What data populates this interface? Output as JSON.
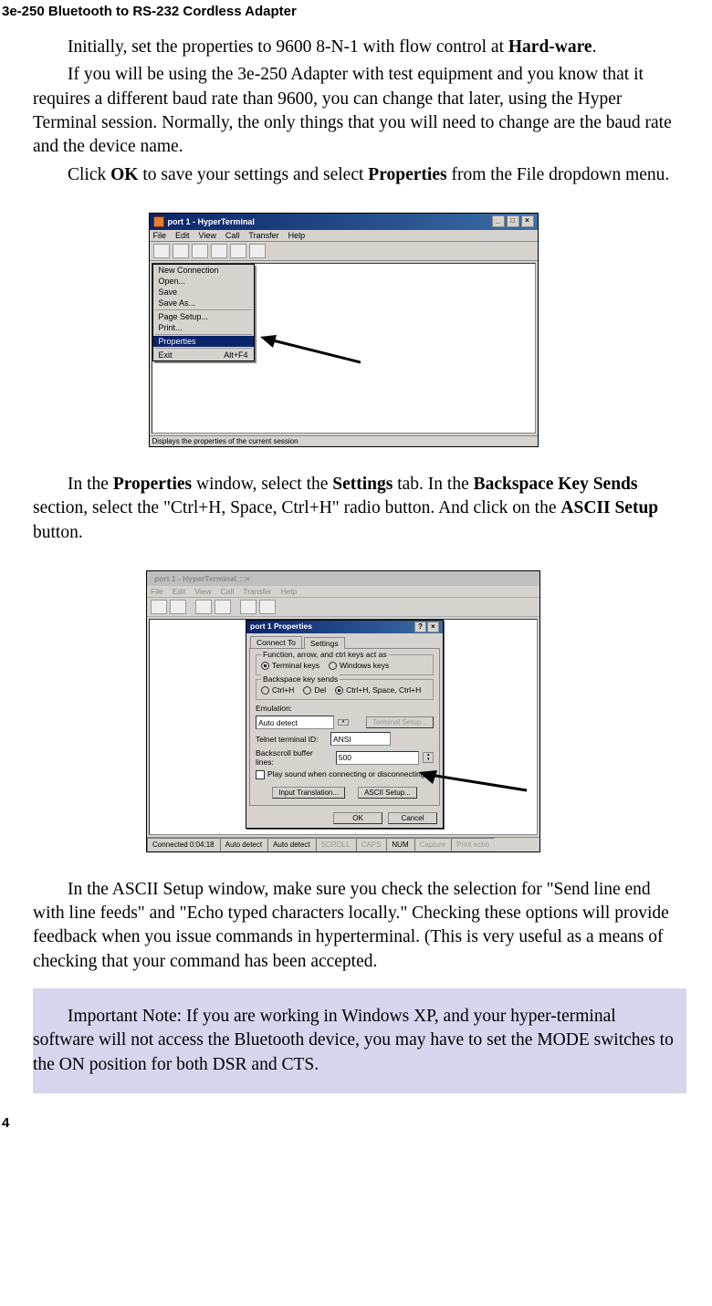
{
  "header": "3e-250 Bluetooth to RS-232 Cordless Adapter",
  "page_number": "4",
  "paragraphs": {
    "p1_a": "Initially, set the properties to 9600 8-N-1 with flow control at ",
    "p1_b": "Hard-ware",
    "p1_c": ".",
    "p2": "If you will be using the 3e-250 Adapter with test equipment and you know that it requires a different baud rate than 9600, you can change that later, using the Hyper Terminal session. Normally, the only things that you will need to change are the baud rate and the device name.",
    "p3_a": "Click ",
    "p3_b": "OK",
    "p3_c": " to save your settings and select ",
    "p3_d": "Properties",
    "p3_e": " from the File dropdown  menu.",
    "p4_a": "In the ",
    "p4_b": "Properties",
    "p4_c": " window, select the ",
    "p4_d": "Settings",
    "p4_e": " tab. In the ",
    "p4_f": "Backspace Key Sends",
    "p4_g": " section, select the \"Ctrl+H, Space, Ctrl+H\" radio button. And click on the ",
    "p4_h": "ASCII Setup",
    "p4_i": " button.",
    "p5": "In the ASCII Setup window, make sure you check the selection for \"Send line end with line feeds\" and \"Echo typed characters locally.\" Checking these options will provide feedback when you issue commands in hyperterminal.  (This is very useful as a means of checking that your command has been accepted.",
    "note": "Important Note: If you are working in Windows XP, and your hyper-terminal software will not access the Bluetooth device, you may have to set the MODE switches to the ON position for both DSR and CTS."
  },
  "fig1": {
    "title": "port 1 - HyperTerminal",
    "menus": [
      "File",
      "Edit",
      "View",
      "Call",
      "Transfer",
      "Help"
    ],
    "dropdown": {
      "items": [
        "New Connection",
        "Open...",
        "Save",
        "Save As..."
      ],
      "sep1_items": [
        "Page Setup...",
        "Print..."
      ],
      "highlight": "Properties",
      "exit": "Exit",
      "exit_accel": "Alt+F4"
    },
    "status": "Displays the properties of the current session"
  },
  "fig2": {
    "title": "port 1 - HyperTerminal",
    "menus": [
      "File",
      "Edit",
      "View",
      "Call",
      "Transfer",
      "Help"
    ],
    "dialog_title": "port 1 Properties",
    "tabs": [
      "Connect To",
      "Settings"
    ],
    "group1_legend": "Function, arrow, and ctrl keys act as",
    "g1_opt1": "Terminal keys",
    "g1_opt2": "Windows keys",
    "group2_legend": "Backspace key sends",
    "g2_opt1": "Ctrl+H",
    "g2_opt2": "Del",
    "g2_opt3": "Ctrl+H, Space, Ctrl+H",
    "emulation_label": "Emulation:",
    "emulation_value": "Auto detect",
    "term_setup_btn": "Terminal Setup...",
    "telnet_label": "Telnet terminal ID:",
    "telnet_value": "ANSI",
    "backscroll_label": "Backscroll buffer lines:",
    "backscroll_value": "500",
    "play_sound": "Play sound when connecting or disconnecting",
    "input_trans_btn": "Input Translation...",
    "ascii_btn": "ASCII Setup...",
    "ok": "OK",
    "cancel": "Cancel",
    "status_cells": [
      "Connected 0:04:18",
      "Auto detect",
      "Auto detect",
      "SCROLL",
      "CAPS",
      "NUM",
      "Capture",
      "Print echo"
    ]
  }
}
